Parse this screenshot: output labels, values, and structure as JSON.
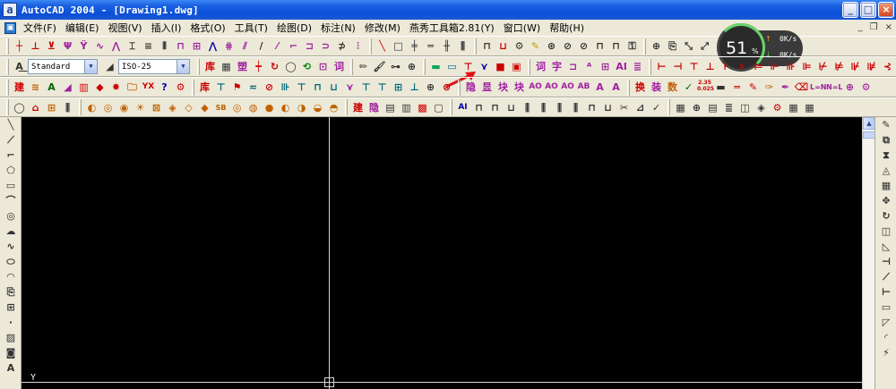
{
  "window": {
    "app_icon": "a",
    "title": "AutoCAD 2004 - [Drawing1.dwg]",
    "controls": {
      "minimize": "_",
      "maximize": "□",
      "close": "×"
    }
  },
  "menubar": {
    "doc_icon": "▣",
    "items": [
      "文件(F)",
      "编辑(E)",
      "视图(V)",
      "插入(I)",
      "格式(O)",
      "工具(T)",
      "绘图(D)",
      "标注(N)",
      "修改(M)",
      "燕秀工具箱2.81(Y)",
      "窗口(W)",
      "帮助(H)"
    ],
    "mdi_controls": {
      "minimize": "_",
      "restore": "❐",
      "close": "×"
    }
  },
  "toolbar_row2": {
    "text_style": "Standard",
    "dim_style": "ISO-25"
  },
  "toolbar_row3": {
    "yx_button": "YX",
    "gl1": "库",
    "gl2": "装",
    "gl3": "字",
    "gl4": "A",
    "ab_hex": "AB",
    "nums": "2.35\n0.025"
  },
  "system_monitor": {
    "cpu_percent": "51",
    "percent_sign": "%",
    "upload": "0K/s",
    "download": "0K/s",
    "colors": {
      "ring": "#69d36a",
      "up": "#f0a030",
      "down": "#5ed35e"
    }
  },
  "canvas": {
    "background": "#000000",
    "ucs_label": "Y"
  }
}
